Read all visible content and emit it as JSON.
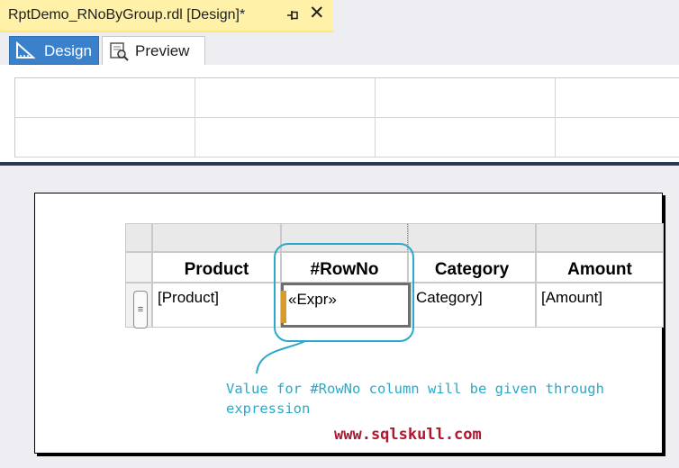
{
  "document_tab": {
    "title": "RptDemo_RNoByGroup.rdl [Design]*",
    "pin_icon": "⊣",
    "close_icon": "✕"
  },
  "view_tabs": [
    {
      "label": "Design",
      "icon": "design-ruler-icon",
      "active": true
    },
    {
      "label": "Preview",
      "icon": "preview-icon",
      "active": false
    }
  ],
  "tablix": {
    "headers": [
      "Product",
      "#RowNo",
      "Category",
      "Amount"
    ],
    "row": [
      "[Product]",
      "«Expr»",
      "Category]",
      "[Amount]"
    ]
  },
  "annotation": {
    "text_line1": "Value for #RowNo column will be given through",
    "text_line2": "expression",
    "color": "#2ba9c8"
  },
  "watermark": "www.sqlskull.com",
  "colors": {
    "tab_background": "#fff1a8",
    "active_tab": "#3b80cb",
    "watermark": "#b0172e"
  }
}
